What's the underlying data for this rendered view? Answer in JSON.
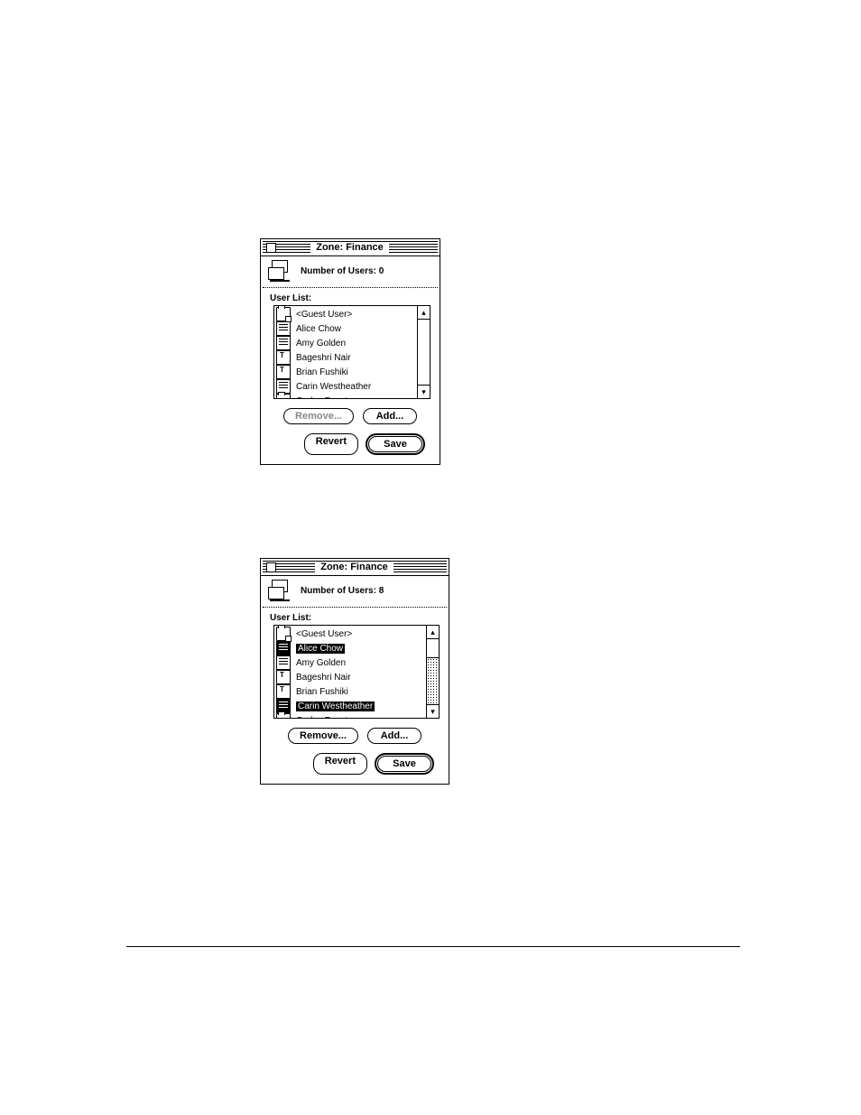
{
  "window1": {
    "title": "Zone: Finance",
    "info_label": "Number of Users:",
    "user_count": "0",
    "list_label": "User List:",
    "scrollbar_dotted": false,
    "items": [
      {
        "name": "<Guest User>",
        "icon": "folder-locked",
        "selected": false
      },
      {
        "name": "Alice Chow",
        "icon": "page",
        "selected": false
      },
      {
        "name": "Amy Golden",
        "icon": "page",
        "selected": false
      },
      {
        "name": "Bageshri Nair",
        "icon": "page-t",
        "selected": false
      },
      {
        "name": "Brian Fushiki",
        "icon": "page-t",
        "selected": false
      },
      {
        "name": "Carin Westheather",
        "icon": "page",
        "selected": false
      },
      {
        "name": "Carlos Fuentes",
        "icon": "folder-locked",
        "selected": false
      }
    ],
    "buttons": {
      "remove": {
        "label": "Remove...",
        "disabled": true
      },
      "add": {
        "label": "Add...",
        "disabled": false
      },
      "revert": {
        "label": "Revert",
        "disabled": false
      },
      "save": {
        "label": "Save",
        "disabled": false,
        "default": true
      }
    }
  },
  "window2": {
    "title": "Zone: Finance",
    "info_label": "Number of Users:",
    "user_count": "8",
    "list_label": "User List:",
    "scrollbar_dotted": true,
    "items": [
      {
        "name": "<Guest User>",
        "icon": "folder-locked",
        "selected": false
      },
      {
        "name": "Alice Chow",
        "icon": "page-dark",
        "selected": true
      },
      {
        "name": "Amy Golden",
        "icon": "page",
        "selected": false
      },
      {
        "name": "Bageshri Nair",
        "icon": "page-t",
        "selected": false
      },
      {
        "name": "Brian Fushiki",
        "icon": "page-t",
        "selected": false
      },
      {
        "name": "Carin Westheather",
        "icon": "page-dark",
        "selected": true
      },
      {
        "name": "Carlos Fuentes",
        "icon": "folder-locked",
        "selected": false
      }
    ],
    "buttons": {
      "remove": {
        "label": "Remove...",
        "disabled": false
      },
      "add": {
        "label": "Add...",
        "disabled": false
      },
      "revert": {
        "label": "Revert",
        "disabled": false
      },
      "save": {
        "label": "Save",
        "disabled": false,
        "default": true
      }
    }
  }
}
